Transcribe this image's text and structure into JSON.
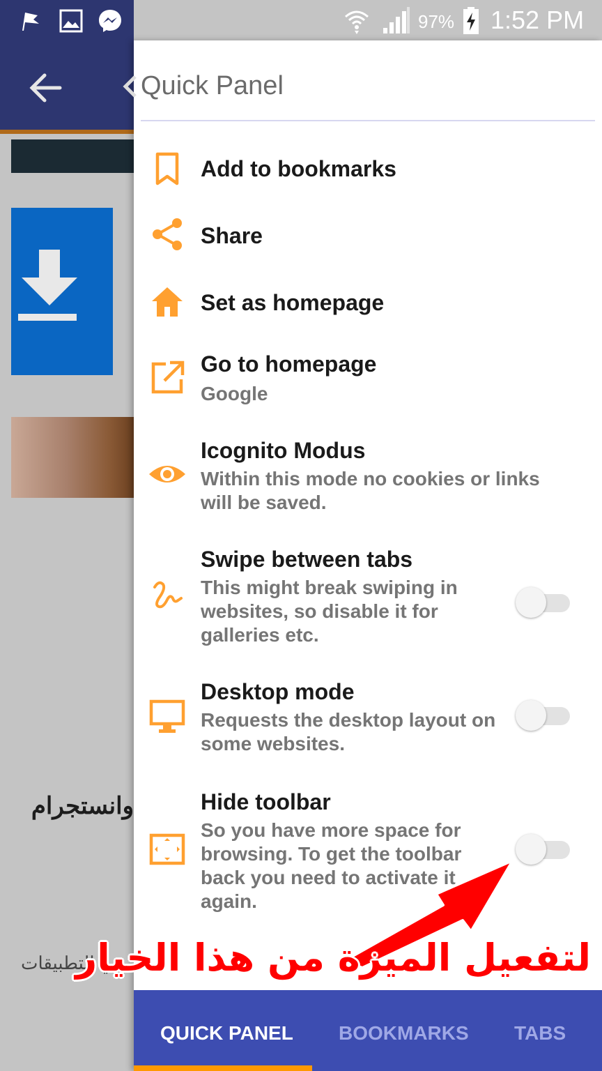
{
  "status_bar": {
    "battery": "97%",
    "time": "1:52 PM",
    "icons": [
      "notification-flag-icon",
      "gallery-icon",
      "messenger-icon",
      "wifi-icon",
      "signal-icon",
      "battery-charging-icon"
    ]
  },
  "background_app": {
    "arabic_heading": "وانستجرام",
    "arabic_text": "في التطبيقات"
  },
  "panel": {
    "title": "Quick Panel",
    "accent_color": "#ffa030",
    "items": [
      {
        "title": "Add to bookmarks",
        "icon": "bookmark-icon"
      },
      {
        "title": "Share",
        "icon": "share-icon"
      },
      {
        "title": "Set as homepage",
        "icon": "home-icon"
      },
      {
        "title": "Go to homepage",
        "subtitle": "Google",
        "icon": "open-external-icon"
      },
      {
        "title": "Icognito Modus",
        "subtitle": "Within this mode no cookies or links will be saved.",
        "icon": "eye-icon"
      },
      {
        "title": "Swipe between tabs",
        "subtitle": "This might break swiping in websites, so disable it for galleries etc.",
        "icon": "gesture-icon",
        "toggle": false
      },
      {
        "title": "Desktop mode",
        "subtitle": "Requests the desktop layout on some websites.",
        "icon": "monitor-icon",
        "toggle": false
      },
      {
        "title": "Hide toolbar",
        "subtitle": "So you have more space for browsing. To get the toolbar back you need to activate it again.",
        "icon": "fullscreen-icon",
        "toggle": false
      }
    ]
  },
  "tabs": [
    {
      "label": "QUICK PANEL",
      "active": true
    },
    {
      "label": "BOOKMARKS",
      "active": false
    },
    {
      "label": "TABS",
      "active": false
    }
  ],
  "annotation": {
    "text": "لتفعيل الميزة من هذا الخيار",
    "color": "#ff0000"
  }
}
